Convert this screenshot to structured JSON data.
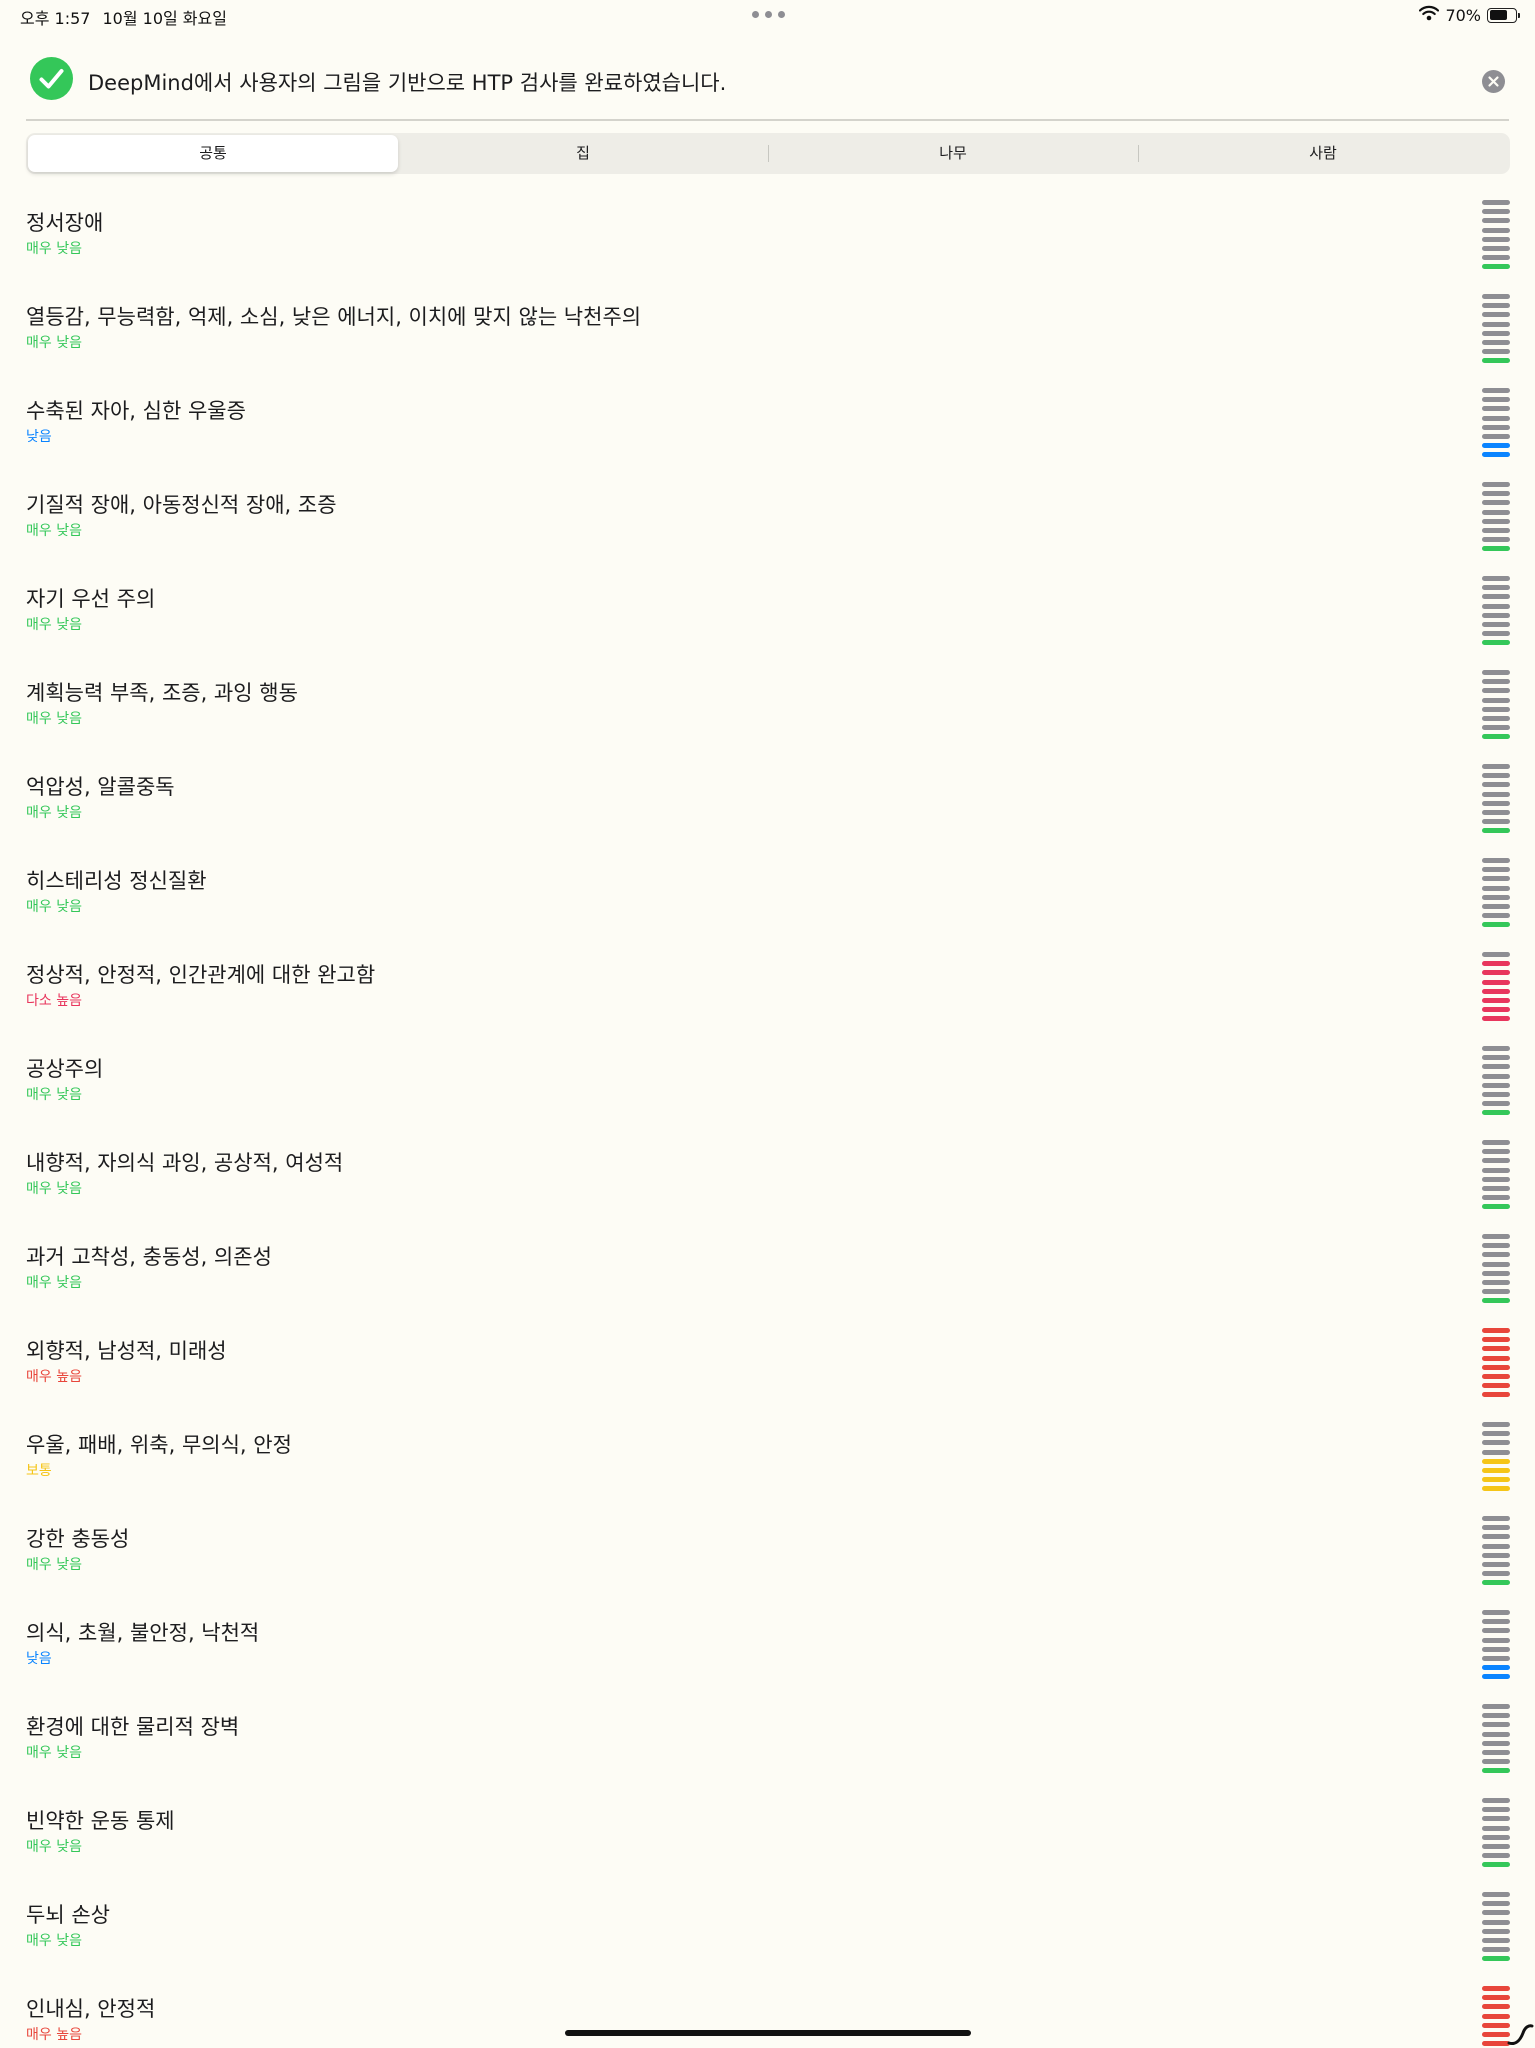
{
  "status_bar": {
    "time": "오후 1:57",
    "date": "10월 10일 화요일",
    "battery": "70%",
    "battery_level": 0.7
  },
  "header": {
    "title": "DeepMind에서 사용자의 그림을 기반으로 HTP 검사를 완료하였습니다."
  },
  "tabs": [
    "공통",
    "집",
    "나무",
    "사람"
  ],
  "selected_tab": 0,
  "colors": {
    "매우 낮음": "#34c759",
    "낮음": "#0a84ff",
    "보통": "#f5c518",
    "다소 높음": "#e8365d",
    "매우 높음": "#e8463b",
    "inactive": "#8e8e93"
  },
  "items": [
    {
      "title": "정서장애",
      "level": "매우 낮음",
      "bars": 1
    },
    {
      "title": "열등감, 무능력함, 억제, 소심, 낮은 에너지, 이치에 맞지 않는 낙천주의",
      "level": "매우 낮음",
      "bars": 1
    },
    {
      "title": "수축된 자아, 심한 우울증",
      "level": "낮음",
      "bars": 2
    },
    {
      "title": "기질적 장애, 아동정신적 장애, 조증",
      "level": "매우 낮음",
      "bars": 1
    },
    {
      "title": "자기 우선 주의",
      "level": "매우 낮음",
      "bars": 1
    },
    {
      "title": "계획능력 부족, 조증, 과잉 행동",
      "level": "매우 낮음",
      "bars": 1
    },
    {
      "title": "억압성, 알콜중독",
      "level": "매우 낮음",
      "bars": 1
    },
    {
      "title": "히스테리성 정신질환",
      "level": "매우 낮음",
      "bars": 1
    },
    {
      "title": "정상적, 안정적, 인간관계에 대한 완고함",
      "level": "다소 높음",
      "bars": 7
    },
    {
      "title": "공상주의",
      "level": "매우 낮음",
      "bars": 1
    },
    {
      "title": "내향적, 자의식 과잉, 공상적, 여성적",
      "level": "매우 낮음",
      "bars": 1
    },
    {
      "title": "과거 고착성, 충동성, 의존성",
      "level": "매우 낮음",
      "bars": 1
    },
    {
      "title": "외향적, 남성적, 미래성",
      "level": "매우 높음",
      "bars": 8
    },
    {
      "title": "우울, 패배, 위축, 무의식, 안정",
      "level": "보통",
      "bars": 4
    },
    {
      "title": "강한 충동성",
      "level": "매우 낮음",
      "bars": 1
    },
    {
      "title": "의식, 초월, 불안정, 낙천적",
      "level": "낮음",
      "bars": 2
    },
    {
      "title": "환경에 대한 물리적 장벽",
      "level": "매우 낮음",
      "bars": 1
    },
    {
      "title": "빈약한 운동 통제",
      "level": "매우 낮음",
      "bars": 1
    },
    {
      "title": "두뇌 손상",
      "level": "매우 낮음",
      "bars": 1
    },
    {
      "title": "인내심, 안정적",
      "level": "매우 높음",
      "bars": 8
    }
  ]
}
